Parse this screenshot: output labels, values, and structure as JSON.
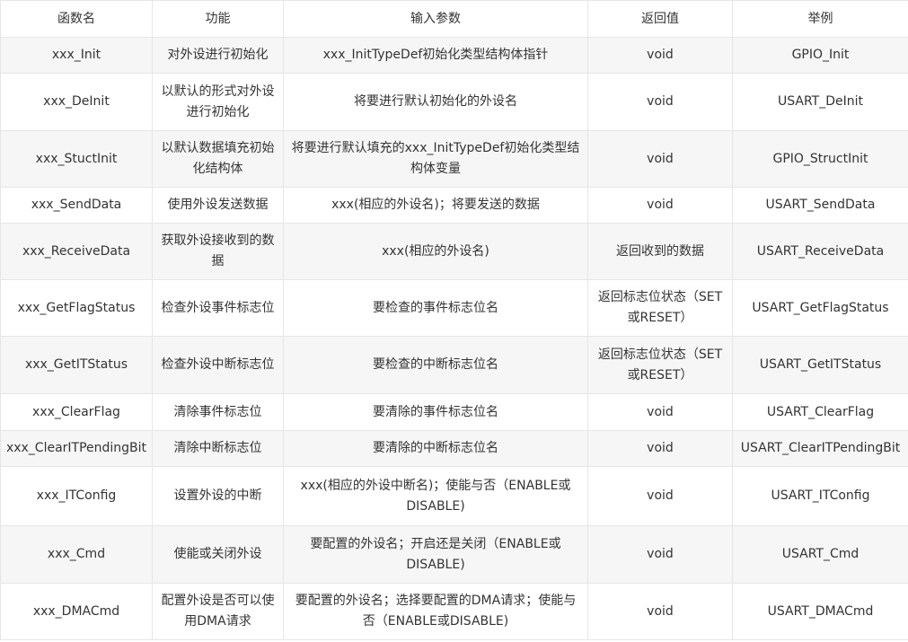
{
  "table": {
    "headers": [
      "函数名",
      "功能",
      "输入参数",
      "返回值",
      "举例"
    ],
    "rows": [
      {
        "name": "xxx_Init",
        "function": "对外设进行初始化",
        "params": "xxx_InitTypeDef初始化类型结构体指针",
        "ret": "void",
        "example": "GPIO_Init"
      },
      {
        "name": "xxx_DeInit",
        "function": "以默认的形式对外设进行初始化",
        "params": "将要进行默认初始化的外设名",
        "ret": "void",
        "example": "USART_DeInit"
      },
      {
        "name": "xxx_StuctInit",
        "function": "以默认数据填充初始化结构体",
        "params": "将要进行默认填充的xxx_InitTypeDef初始化类型结构体变量",
        "ret": "void",
        "example": "GPIO_StructInit"
      },
      {
        "name": "xxx_SendData",
        "function": "使用外设发送数据",
        "params": "xxx(相应的外设名)；将要发送的数据",
        "ret": "void",
        "example": "USART_SendData"
      },
      {
        "name": "xxx_ReceiveData",
        "function": "获取外设接收到的数据",
        "params": "xxx(相应的外设名)",
        "ret": "返回收到的数据",
        "example": "USART_ReceiveData"
      },
      {
        "name": "xxx_GetFlagStatus",
        "function": "检查外设事件标志位",
        "params": "要检查的事件标志位名",
        "ret": "返回标志位状态（SET或RESET）",
        "example": "USART_GetFlagStatus"
      },
      {
        "name": "xxx_GetITStatus",
        "function": "检查外设中断标志位",
        "params": "要检查的中断标志位名",
        "ret": "返回标志位状态（SET或RESET）",
        "example": "USART_GetITStatus"
      },
      {
        "name": "xxx_ClearFlag",
        "function": "清除事件标志位",
        "params": "要清除的事件标志位名",
        "ret": "void",
        "example": "USART_ClearFlag"
      },
      {
        "name": "xxx_ClearITPendingBit",
        "function": "清除中断标志位",
        "params": "要清除的中断标志位名",
        "ret": "void",
        "example": "USART_ClearITPendingBit"
      },
      {
        "name": "xxx_ITConfig",
        "function": "设置外设的中断",
        "params": "xxx(相应的外设中断名)；使能与否（ENABLE或DISABLE)",
        "ret": "void",
        "example": "USART_ITConfig"
      },
      {
        "name": "xxx_Cmd",
        "function": "使能或关闭外设",
        "params": "要配置的外设名；开启还是关闭（ENABLE或DISABLE)",
        "ret": "void",
        "example": "USART_Cmd"
      },
      {
        "name": "xxx_DMACmd",
        "function": "配置外设是否可以使用DMA请求",
        "params": "要配置的外设名；选择要配置的DMA请求；使能与否（ENABLE或DISABLE)",
        "ret": "void",
        "example": "USART_DMACmd"
      }
    ]
  }
}
